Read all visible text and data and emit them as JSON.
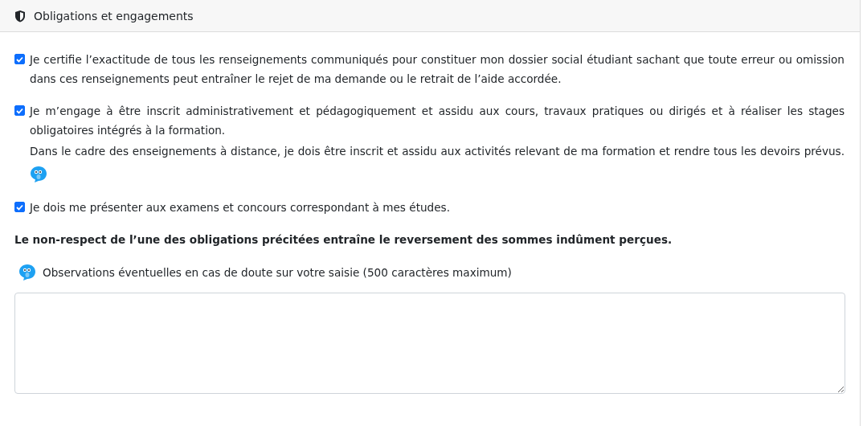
{
  "header": {
    "title": "Obligations et engagements"
  },
  "commitments": [
    {
      "kind": "plain",
      "checked": true,
      "paragraphs": [
        "Je certifie l’exactitude de tous les renseignements communiqués pour constituer mon dossier social étudiant sachant que toute erreur ou omission dans ces renseignements peut entraîner le rejet de ma demande ou le retrait de l’aide accordée."
      ]
    },
    {
      "kind": "help",
      "checked": true,
      "paragraphs": [
        "Je m’engage à être inscrit administrativement et pédagogiquement et assidu aux cours, travaux pratiques ou dirigés et à réaliser les stages obligatoires intégrés à la formation.",
        "Dans le cadre des enseignements à distance, je dois être inscrit et assidu aux activités relevant de ma formation et rendre tous les devoirs prévus."
      ]
    },
    {
      "kind": "plain",
      "checked": true,
      "paragraphs": [
        "Je dois me présenter aux examens et concours correspondant à mes études."
      ]
    }
  ],
  "warning": "Le non-respect de l’une des obligations précitées entraîne le reversement des sommes indûment perçues.",
  "observations": {
    "label": "Observations éventuelles en cas de doute sur votre saisie (500 caractères maximum)"
  }
}
